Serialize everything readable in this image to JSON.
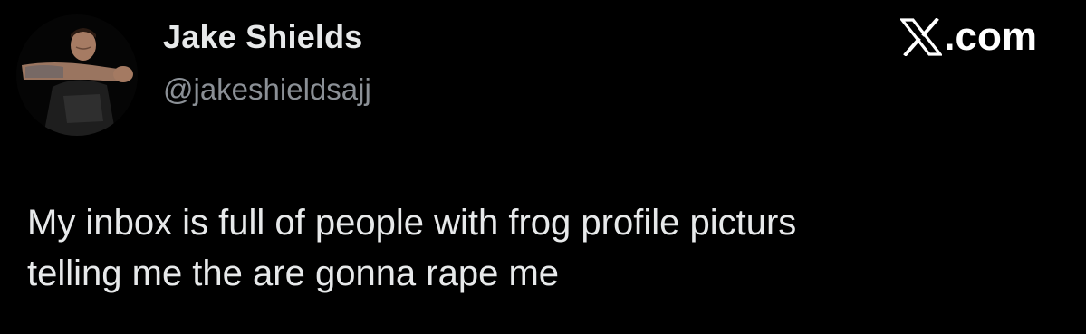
{
  "tweet": {
    "author": {
      "display_name": "Jake Shields",
      "handle": "@jakeshieldsajj"
    },
    "brand_text": ".com",
    "brand_icon": "x-logo-icon",
    "text_lines": [
      "My inbox is full of people with frog profile picturs",
      "telling me the are gonna rape me"
    ]
  },
  "colors": {
    "background": "#000000",
    "name": "#e7e9ea",
    "handle": "#8b9096",
    "text": "#e7e9ea"
  }
}
